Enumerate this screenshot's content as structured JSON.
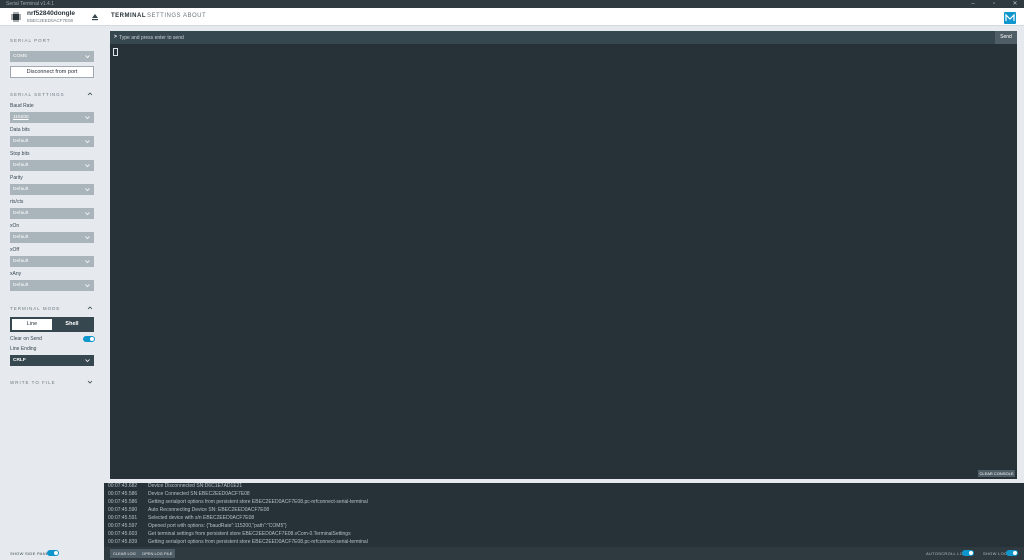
{
  "window": {
    "title": "Serial Terminal v1.4.1"
  },
  "device": {
    "name": "nrf52840dongle",
    "serial": "EBEC2EED0ACF7E08"
  },
  "tabs": [
    {
      "label": "TERMINAL"
    },
    {
      "label": "SETTINGS"
    },
    {
      "label": "ABOUT"
    }
  ],
  "sidebar": {
    "serial_port": {
      "header": "SERIAL PORT",
      "value": "COM5",
      "disconnect_label": "Disconnect from port"
    },
    "serial_settings": {
      "header": "SERIAL SETTINGS",
      "fields": [
        {
          "label": "Baud Rate",
          "value": "115200"
        },
        {
          "label": "Data bits",
          "value": "Default"
        },
        {
          "label": "Stop bits",
          "value": "Default"
        },
        {
          "label": "Parity",
          "value": "Default"
        },
        {
          "label": "rts/cts",
          "value": "Default"
        },
        {
          "label": "xOn",
          "value": "Default"
        },
        {
          "label": "xOff",
          "value": "Default"
        },
        {
          "label": "xAny",
          "value": "Default"
        }
      ]
    },
    "terminal_mode": {
      "header": "TERMINAL MODE",
      "line_label": "Line",
      "shell_label": "Shell",
      "clear_on_send_label": "Clear on Send",
      "line_ending_label": "Line Ending",
      "line_ending_value": "CRLF"
    },
    "write_to_file": {
      "header": "WRITE TO FILE"
    }
  },
  "terminal": {
    "prompt": ">",
    "placeholder": "Type and press enter to send",
    "send_label": "Send",
    "clear_console_label": "CLEAR CONSOLE"
  },
  "log": [
    {
      "time": "00:07:43.682",
      "message": "Device Disconnected SN:D6C1E7AD1E21"
    },
    {
      "time": "00:07:45.586",
      "message": "Device Connected SN:EBEC2EED0ACF7E08"
    },
    {
      "time": "00:07:45.586",
      "message": "Getting serialport options from persistent store EBEC2EED0ACF7E08.pc-nrfconnect-serial-terminal"
    },
    {
      "time": "00:07:45.590",
      "message": "Auto Reconnecting Device SN: EBEC2EED0ACF7E08"
    },
    {
      "time": "00:07:45.591",
      "message": "Selected device with s/n EBEC2EED0ACF7E08"
    },
    {
      "time": "00:07:45.597",
      "message": "Opened port with options: {\"baudRate\":115200,\"path\":\"COM5\"}"
    },
    {
      "time": "00:07:45.603",
      "message": "Get terminal settings from persistent store EBEC2EED0ACF7E08.vCom-0.TerminalSettings"
    },
    {
      "time": "00:07:45.839",
      "message": "Getting serialport options from persistent store EBEC2EED0ACF7E08.pc-nrfconnect-serial-terminal"
    }
  ],
  "footer": {
    "show_side_panel_label": "SHOW SIDE PANEL",
    "clear_log_label": "CLEAR LOG",
    "open_log_file_label": "OPEN LOG FILE",
    "autoscroll_log_label": "AUTOSCROLL LOG",
    "show_log_label": "SHOW LOG"
  },
  "colors": {
    "accent": "#0f97cd",
    "terminal_bg": "#263238",
    "sidebar_bg": "#e6eaef"
  }
}
